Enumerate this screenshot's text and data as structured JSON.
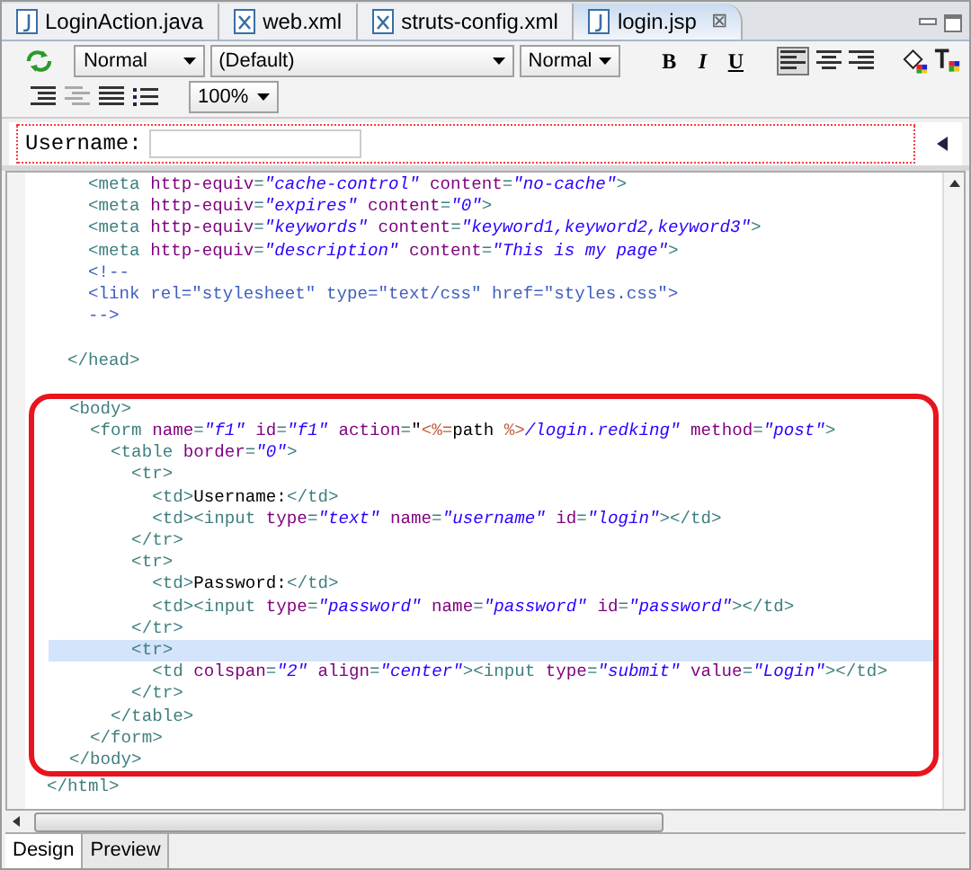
{
  "tabs": [
    {
      "label": "LoginAction.java",
      "kind": "java",
      "selected": false
    },
    {
      "label": "web.xml",
      "kind": "xml",
      "selected": false
    },
    {
      "label": "struts-config.xml",
      "kind": "xml",
      "selected": false
    },
    {
      "label": "login.jsp",
      "kind": "jsp",
      "selected": true,
      "close": "⊠"
    }
  ],
  "toolbar": {
    "paragraph": "Normal",
    "font": "(Default)",
    "size": "Normal",
    "bold": "B",
    "italic": "I",
    "underline": "U",
    "zoom": "100%"
  },
  "design": {
    "label": "Username:"
  },
  "code_sections": [
    {
      "framed": false,
      "lines": [
        {
          "current": false,
          "tokens": [
            {
              "kind": "tag",
              "text": "    <meta "
            },
            {
              "kind": "attr",
              "text": "http-equiv"
            },
            {
              "kind": "tag",
              "text": "="
            },
            {
              "kind": "value",
              "text": "\"cache-control\" "
            },
            {
              "kind": "attr",
              "text": "content"
            },
            {
              "kind": "tag",
              "text": "="
            },
            {
              "kind": "value",
              "text": "\"no-cache\""
            },
            {
              "kind": "tag",
              "text": ">"
            }
          ]
        },
        {
          "current": false,
          "tokens": [
            {
              "kind": "tag",
              "text": "    <meta "
            },
            {
              "kind": "attr",
              "text": "http-equiv"
            },
            {
              "kind": "tag",
              "text": "="
            },
            {
              "kind": "value",
              "text": "\"expires\" "
            },
            {
              "kind": "attr",
              "text": "content"
            },
            {
              "kind": "tag",
              "text": "="
            },
            {
              "kind": "value",
              "text": "\"0\""
            },
            {
              "kind": "tag",
              "text": ">"
            }
          ]
        },
        {
          "current": false,
          "tokens": [
            {
              "kind": "tag",
              "text": "    <meta "
            },
            {
              "kind": "attr",
              "text": "http-equiv"
            },
            {
              "kind": "tag",
              "text": "="
            },
            {
              "kind": "value",
              "text": "\"keywords\" "
            },
            {
              "kind": "attr",
              "text": "content"
            },
            {
              "kind": "tag",
              "text": "="
            },
            {
              "kind": "value",
              "text": "\"keyword1,keyword2,keyword3\""
            },
            {
              "kind": "tag",
              "text": ">"
            }
          ]
        },
        {
          "current": false,
          "tokens": [
            {
              "kind": "tag",
              "text": "    <meta "
            },
            {
              "kind": "attr",
              "text": "http-equiv"
            },
            {
              "kind": "tag",
              "text": "="
            },
            {
              "kind": "value",
              "text": "\"description\" "
            },
            {
              "kind": "attr",
              "text": "content"
            },
            {
              "kind": "tag",
              "text": "="
            },
            {
              "kind": "value",
              "text": "\"This is my page\""
            },
            {
              "kind": "tag",
              "text": ">"
            }
          ]
        },
        {
          "current": false,
          "tokens": [
            {
              "kind": "comment",
              "text": "    <!--"
            }
          ]
        },
        {
          "current": false,
          "tokens": [
            {
              "kind": "comment",
              "text": "    <link rel=\"stylesheet\" type=\"text/css\" href=\"styles.css\">"
            }
          ]
        },
        {
          "current": false,
          "tokens": [
            {
              "kind": "comment",
              "text": "    -->"
            }
          ]
        },
        {
          "current": false
        },
        {
          "current": false,
          "tokens": [
            {
              "kind": "tag",
              "text": "  </head>"
            }
          ]
        },
        {
          "current": false
        }
      ]
    },
    {
      "framed": true,
      "lines": [
        {
          "current": false,
          "tokens": [
            {
              "kind": "tag",
              "text": "  <body>"
            }
          ]
        },
        {
          "current": false,
          "tokens": [
            {
              "kind": "tag",
              "text": "    <form "
            },
            {
              "kind": "attr",
              "text": "name"
            },
            {
              "kind": "tag",
              "text": "="
            },
            {
              "kind": "value",
              "text": "\"f1\" "
            },
            {
              "kind": "attr",
              "text": "id"
            },
            {
              "kind": "tag",
              "text": "="
            },
            {
              "kind": "value",
              "text": "\"f1\" "
            },
            {
              "kind": "attr",
              "text": "action"
            },
            {
              "kind": "tag",
              "text": "="
            },
            {
              "kind": "plain",
              "text": "\""
            },
            {
              "kind": "jsp",
              "text": "<%="
            },
            {
              "kind": "plain",
              "text": "path "
            },
            {
              "kind": "jsp",
              "text": "%>"
            },
            {
              "kind": "value",
              "text": "/login.redking\" "
            },
            {
              "kind": "attr",
              "text": "method"
            },
            {
              "kind": "tag",
              "text": "="
            },
            {
              "kind": "value",
              "text": "\"post\""
            },
            {
              "kind": "tag",
              "text": ">"
            }
          ]
        },
        {
          "current": false,
          "tokens": [
            {
              "kind": "tag",
              "text": "      <table "
            },
            {
              "kind": "attr",
              "text": "border"
            },
            {
              "kind": "tag",
              "text": "="
            },
            {
              "kind": "value",
              "text": "\"0\""
            },
            {
              "kind": "tag",
              "text": ">"
            }
          ]
        },
        {
          "current": false,
          "tokens": [
            {
              "kind": "tag",
              "text": "        <tr>"
            }
          ]
        },
        {
          "current": false,
          "tokens": [
            {
              "kind": "tag",
              "text": "          <td>"
            },
            {
              "kind": "plain",
              "text": "Username:"
            },
            {
              "kind": "tag",
              "text": "</td>"
            }
          ]
        },
        {
          "current": false,
          "tokens": [
            {
              "kind": "tag",
              "text": "          <td><input "
            },
            {
              "kind": "attr",
              "text": "type"
            },
            {
              "kind": "tag",
              "text": "="
            },
            {
              "kind": "value",
              "text": "\"text\" "
            },
            {
              "kind": "attr",
              "text": "name"
            },
            {
              "kind": "tag",
              "text": "="
            },
            {
              "kind": "value",
              "text": "\"username\" "
            },
            {
              "kind": "attr",
              "text": "id"
            },
            {
              "kind": "tag",
              "text": "="
            },
            {
              "kind": "value",
              "text": "\"login\""
            },
            {
              "kind": "tag",
              "text": "></td>"
            }
          ]
        },
        {
          "current": false,
          "tokens": [
            {
              "kind": "tag",
              "text": "        </tr>"
            }
          ]
        },
        {
          "current": false,
          "tokens": [
            {
              "kind": "tag",
              "text": "        <tr>"
            }
          ]
        },
        {
          "current": false,
          "tokens": [
            {
              "kind": "tag",
              "text": "          <td>"
            },
            {
              "kind": "plain",
              "text": "Password:"
            },
            {
              "kind": "tag",
              "text": "</td>"
            }
          ]
        },
        {
          "current": false,
          "tokens": [
            {
              "kind": "tag",
              "text": "          <td><input "
            },
            {
              "kind": "attr",
              "text": "type"
            },
            {
              "kind": "tag",
              "text": "="
            },
            {
              "kind": "value",
              "text": "\"password\" "
            },
            {
              "kind": "attr",
              "text": "name"
            },
            {
              "kind": "tag",
              "text": "="
            },
            {
              "kind": "value",
              "text": "\"password\" "
            },
            {
              "kind": "attr",
              "text": "id"
            },
            {
              "kind": "tag",
              "text": "="
            },
            {
              "kind": "value",
              "text": "\"password\""
            },
            {
              "kind": "tag",
              "text": "></td>"
            }
          ]
        },
        {
          "current": false,
          "tokens": [
            {
              "kind": "tag",
              "text": "        </tr>"
            }
          ]
        },
        {
          "current": true,
          "tokens": [
            {
              "kind": "tag",
              "text": "        <tr>"
            }
          ]
        },
        {
          "current": false,
          "tokens": [
            {
              "kind": "tag",
              "text": "          <td "
            },
            {
              "kind": "attr",
              "text": "colspan"
            },
            {
              "kind": "tag",
              "text": "="
            },
            {
              "kind": "value",
              "text": "\"2\" "
            },
            {
              "kind": "attr",
              "text": "align"
            },
            {
              "kind": "tag",
              "text": "="
            },
            {
              "kind": "value",
              "text": "\"center\""
            },
            {
              "kind": "tag",
              "text": "><input "
            },
            {
              "kind": "attr",
              "text": "type"
            },
            {
              "kind": "tag",
              "text": "="
            },
            {
              "kind": "value",
              "text": "\"submit\" "
            },
            {
              "kind": "attr",
              "text": "value"
            },
            {
              "kind": "tag",
              "text": "="
            },
            {
              "kind": "value",
              "text": "\"Login\""
            },
            {
              "kind": "tag",
              "text": "></td>"
            }
          ]
        },
        {
          "current": false,
          "tokens": [
            {
              "kind": "tag",
              "text": "        </tr>"
            }
          ]
        },
        {
          "current": false,
          "tokens": [
            {
              "kind": "tag",
              "text": "      </table>"
            }
          ]
        },
        {
          "current": false,
          "tokens": [
            {
              "kind": "tag",
              "text": "    </form>"
            }
          ]
        },
        {
          "current": false,
          "tokens": [
            {
              "kind": "tag",
              "text": "  </body>"
            }
          ]
        }
      ]
    },
    {
      "framed": false,
      "lines": [
        {
          "current": false,
          "tokens": [
            {
              "kind": "tag",
              "text": "</html>"
            }
          ]
        }
      ]
    }
  ],
  "bottom_tabs": [
    {
      "label": "Design",
      "selected": true
    },
    {
      "label": "Preview",
      "selected": false
    }
  ]
}
